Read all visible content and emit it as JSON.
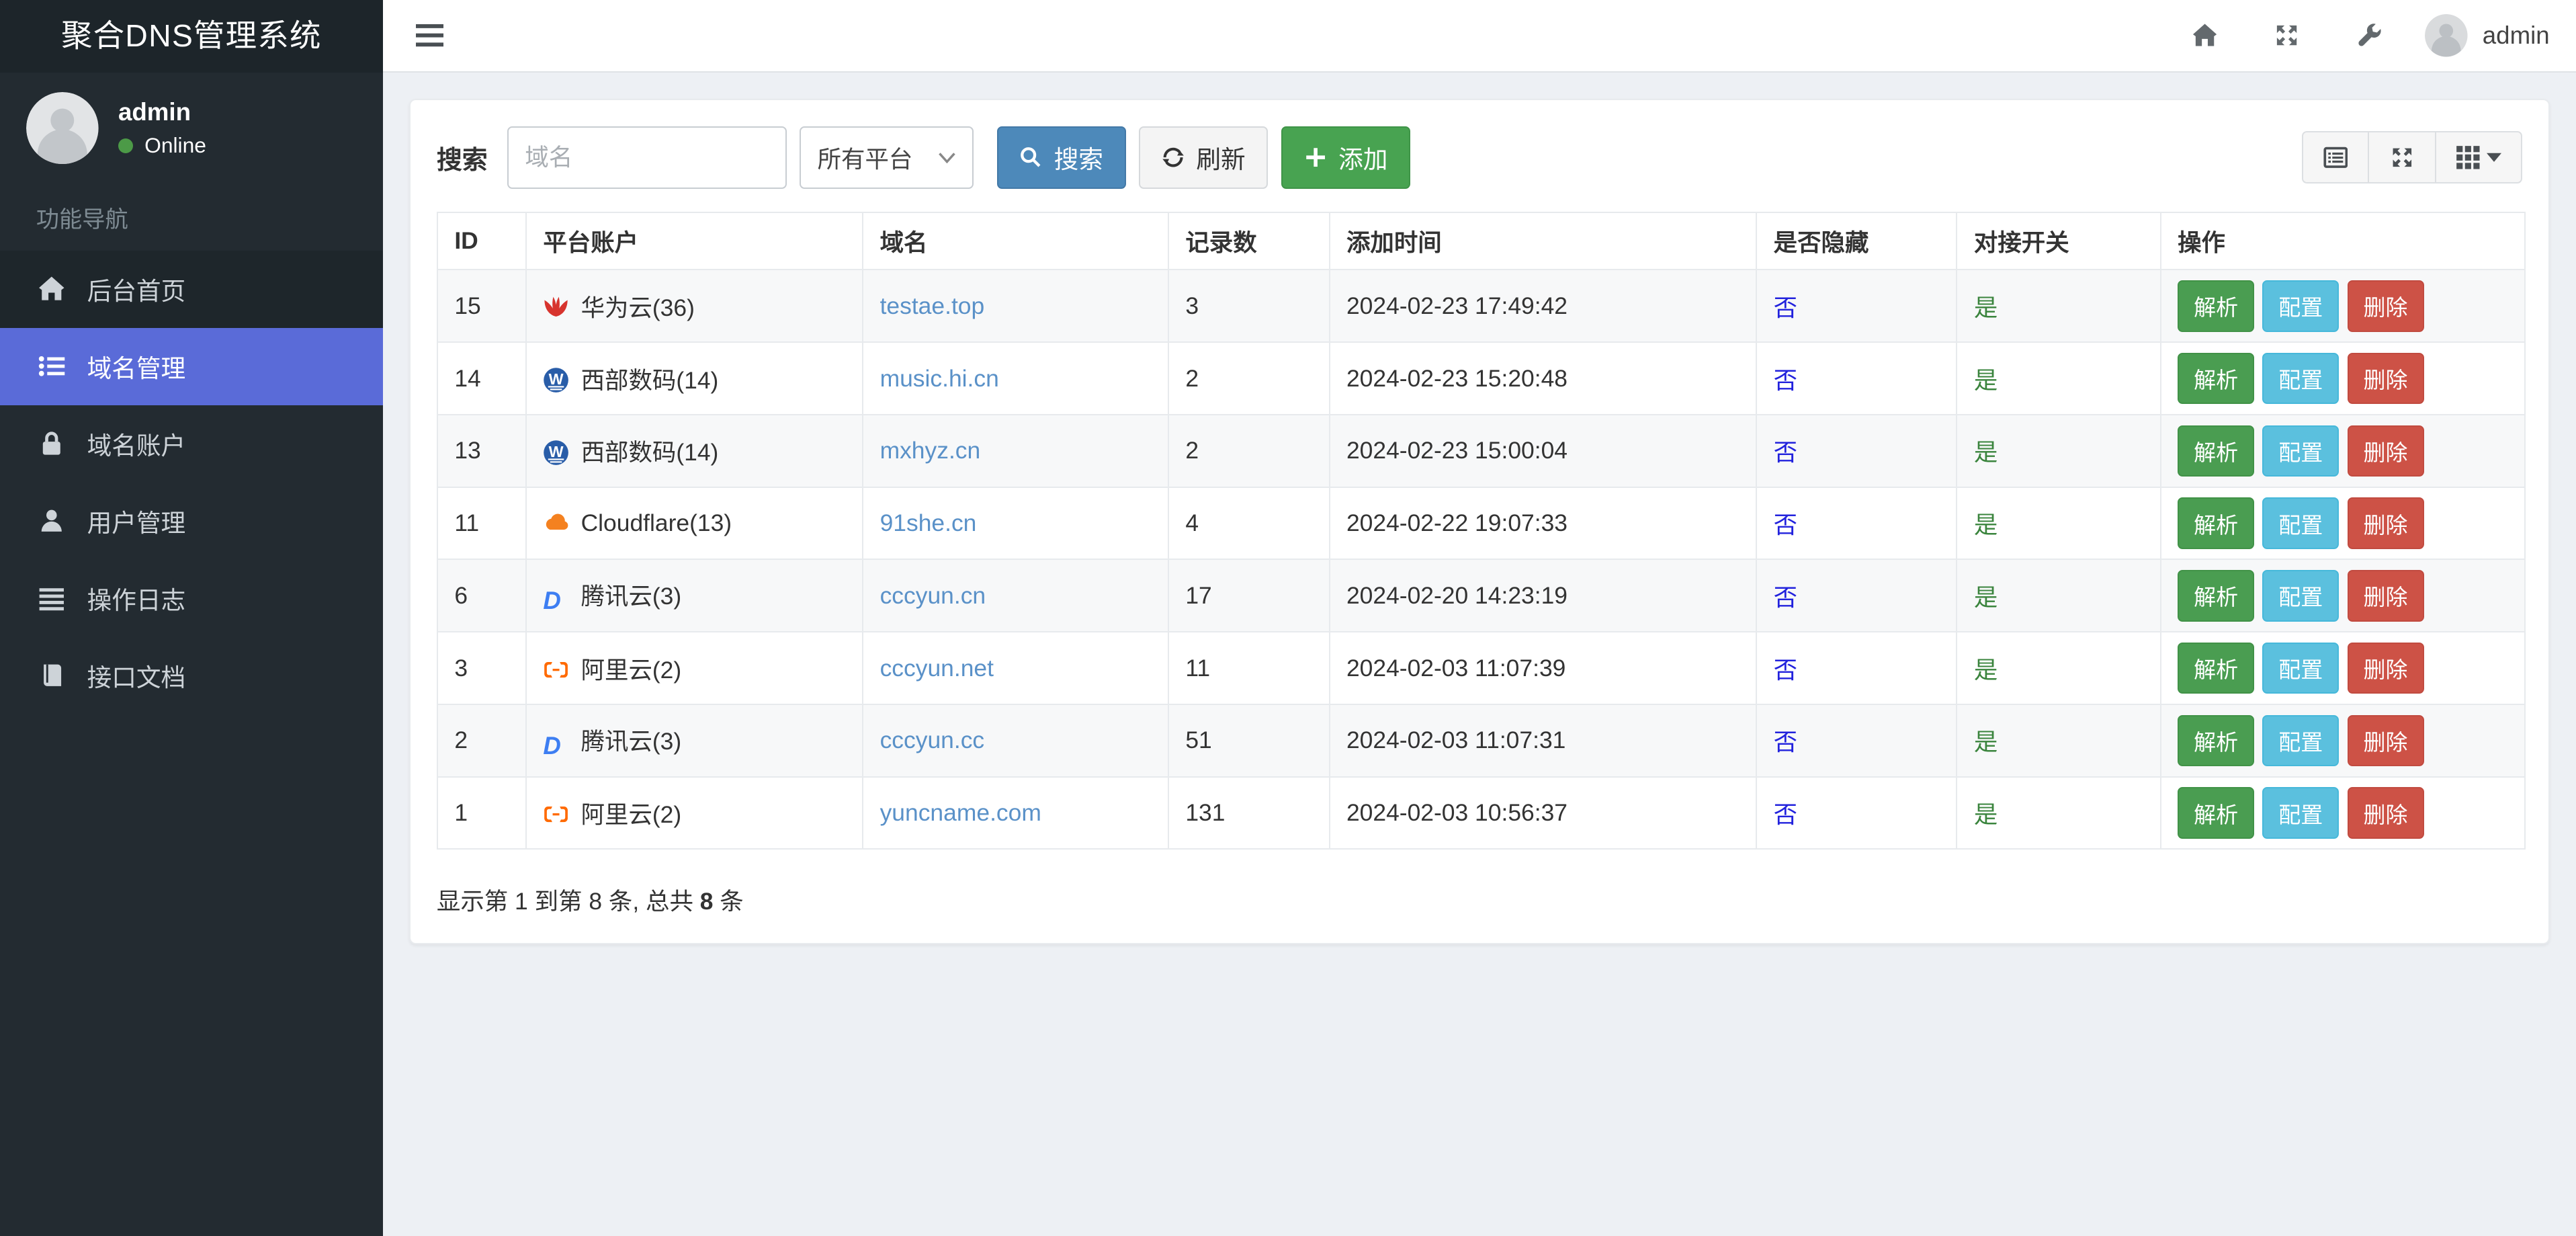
{
  "app": {
    "title": "聚合DNS管理系统"
  },
  "topbar": {
    "username": "admin"
  },
  "sidebar": {
    "user": {
      "name": "admin",
      "status": "Online"
    },
    "section_label": "功能导航",
    "items": [
      {
        "key": "home",
        "label": "后台首页",
        "icon": "home-icon",
        "active": false
      },
      {
        "key": "domain-manage",
        "label": "域名管理",
        "icon": "list-icon",
        "active": true
      },
      {
        "key": "domain-account",
        "label": "域名账户",
        "icon": "lock-icon",
        "active": false
      },
      {
        "key": "user-manage",
        "label": "用户管理",
        "icon": "user-icon",
        "active": false
      },
      {
        "key": "operation-log",
        "label": "操作日志",
        "icon": "log-icon",
        "active": false
      },
      {
        "key": "api-docs",
        "label": "接口文档",
        "icon": "book-icon",
        "active": false
      }
    ]
  },
  "toolbar": {
    "search_label": "搜索",
    "search_placeholder": "域名",
    "platform_select": "所有平台",
    "search_button": "搜索",
    "refresh_button": "刷新",
    "add_button": "添加"
  },
  "table": {
    "columns": [
      "ID",
      "平台账户",
      "域名",
      "记录数",
      "添加时间",
      "是否隐藏",
      "对接开关",
      "操作"
    ],
    "action_labels": {
      "resolve": "解析",
      "config": "配置",
      "delete": "删除"
    },
    "rows": [
      {
        "id": "15",
        "platform": "华为云(36)",
        "platform_icon": "huawei",
        "domain": "testae.top",
        "records": "3",
        "added": "2024-02-23 17:49:42",
        "hidden": "否",
        "switch": "是"
      },
      {
        "id": "14",
        "platform": "西部数码(14)",
        "platform_icon": "west",
        "domain": "music.hi.cn",
        "records": "2",
        "added": "2024-02-23 15:20:48",
        "hidden": "否",
        "switch": "是"
      },
      {
        "id": "13",
        "platform": "西部数码(14)",
        "platform_icon": "west",
        "domain": "mxhyz.cn",
        "records": "2",
        "added": "2024-02-23 15:00:04",
        "hidden": "否",
        "switch": "是"
      },
      {
        "id": "11",
        "platform": "Cloudflare(13)",
        "platform_icon": "cloudflare",
        "domain": "91she.cn",
        "records": "4",
        "added": "2024-02-22 19:07:33",
        "hidden": "否",
        "switch": "是"
      },
      {
        "id": "6",
        "platform": "腾讯云(3)",
        "platform_icon": "tencent",
        "domain": "cccyun.cn",
        "records": "17",
        "added": "2024-02-20 14:23:19",
        "hidden": "否",
        "switch": "是"
      },
      {
        "id": "3",
        "platform": "阿里云(2)",
        "platform_icon": "aliyun",
        "domain": "cccyun.net",
        "records": "11",
        "added": "2024-02-03 11:07:39",
        "hidden": "否",
        "switch": "是"
      },
      {
        "id": "2",
        "platform": "腾讯云(3)",
        "platform_icon": "tencent",
        "domain": "cccyun.cc",
        "records": "51",
        "added": "2024-02-03 11:07:31",
        "hidden": "否",
        "switch": "是"
      },
      {
        "id": "1",
        "platform": "阿里云(2)",
        "platform_icon": "aliyun",
        "domain": "yuncname.com",
        "records": "131",
        "added": "2024-02-03 10:56:37",
        "hidden": "否",
        "switch": "是"
      }
    ],
    "summary": {
      "prefix": "显示第 1 到第 8 条, 总共 ",
      "total": "8",
      "suffix": " 条"
    }
  },
  "colors": {
    "active": "#5a6bd8",
    "primary": "#4d89ba",
    "success": "#48a351",
    "action-green": "#4a9d51",
    "info": "#5bc0de",
    "danger": "#cd5246",
    "link": "#5a91c8",
    "flag-no": "#2222dd",
    "flag-yes": "#3a843d",
    "online": "#4c9a47",
    "huawei": "#d7342e",
    "west": "#295da8",
    "cloudflare": "#f48120",
    "tencent": "#3d7ef2",
    "aliyun": "#ff6a00"
  }
}
